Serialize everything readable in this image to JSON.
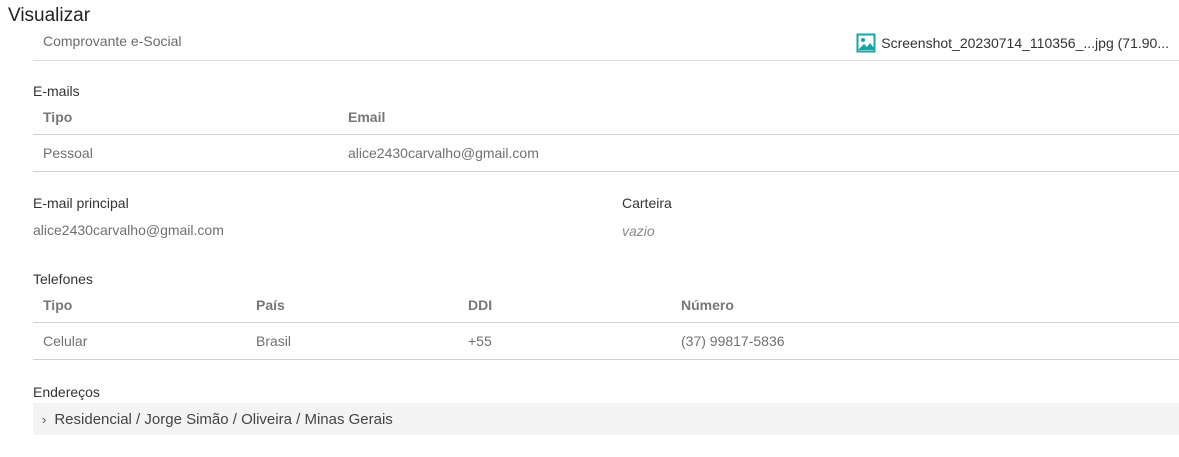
{
  "page": {
    "title": "Visualizar"
  },
  "document": {
    "label": "Comprovante e-Social",
    "file_name": "Screenshot_20230714_110356_...jpg (71.90...",
    "file_icon": "image-file-icon"
  },
  "emails": {
    "section_label": "E-mails",
    "columns": [
      "Tipo",
      "Email"
    ],
    "rows": [
      {
        "tipo": "Pessoal",
        "email": "alice2430carvalho@gmail.com"
      }
    ]
  },
  "fields": {
    "email_principal_label": "E-mail principal",
    "email_principal_value": "alice2430carvalho@gmail.com",
    "carteira_label": "Carteira",
    "carteira_value": "vazio"
  },
  "telefones": {
    "section_label": "Telefones",
    "columns": [
      "Tipo",
      "País",
      "DDI",
      "Número"
    ],
    "rows": [
      {
        "tipo": "Celular",
        "pais": "Brasil",
        "ddi": "+55",
        "numero": "(37) 99817-5836"
      }
    ]
  },
  "enderecos": {
    "section_label": "Endereços",
    "items": [
      {
        "label": "Residencial / Jorge Simão / Oliveira / Minas Gerais"
      }
    ]
  },
  "colors": {
    "accent": "#1aa3a3",
    "divider": "#d0d0d0",
    "address_bg": "#f4f4f4"
  }
}
